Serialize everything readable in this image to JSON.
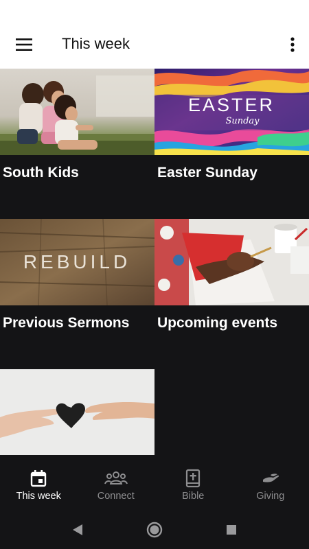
{
  "header": {
    "title": "This week",
    "menu_icon": "hamburger-menu-icon",
    "more_icon": "more-vertical-icon"
  },
  "cards": [
    {
      "label": "South Kids",
      "image": "children-sitting-photo"
    },
    {
      "label": "Easter Sunday",
      "image": "easter-sunday-graphic",
      "art_text_1": "EASTER",
      "art_text_2": "Sunday"
    },
    {
      "label": "Previous Sermons",
      "image": "rebuild-graphic",
      "art_text": "REBUILD"
    },
    {
      "label": "Upcoming events",
      "image": "hand-writing-calendar-photo"
    },
    {
      "label": "",
      "image": "hands-passing-paper-heart-photo"
    }
  ],
  "bottom_nav": [
    {
      "label": "This week",
      "icon": "calendar-icon",
      "active": true
    },
    {
      "label": "Connect",
      "icon": "group-icon",
      "active": false
    },
    {
      "label": "Bible",
      "icon": "bible-icon",
      "active": false
    },
    {
      "label": "Giving",
      "icon": "giving-hand-icon",
      "active": false
    }
  ],
  "system_nav": [
    "back-icon",
    "home-icon",
    "recents-icon"
  ],
  "colors": {
    "background": "#141416",
    "appbar": "#ffffff",
    "nav_active": "#ffffff",
    "nav_inactive": "#8e8e90"
  }
}
